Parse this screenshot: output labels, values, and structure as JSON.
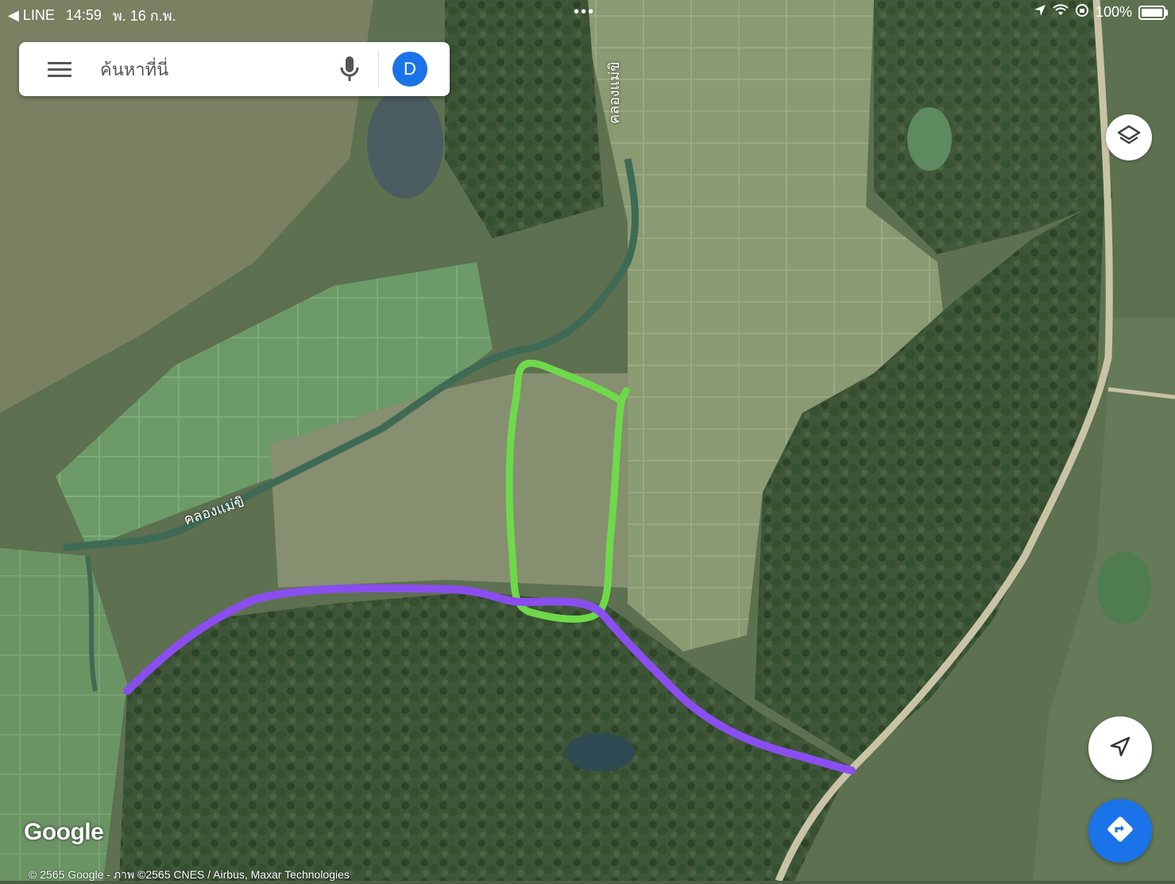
{
  "status_bar": {
    "back_app": "◀ LINE",
    "time": "14:59",
    "date": "พ. 16 ก.พ.",
    "dots": "•••",
    "battery": "100%",
    "battery_level": 1.0
  },
  "search": {
    "placeholder": "ค้นหาที่นี่",
    "avatar_letter": "D"
  },
  "map": {
    "labels": [
      {
        "text": "คลองแม่ขิ"
      },
      {
        "text": "คลองแม่ขิ"
      }
    ],
    "annotation_colors": {
      "boundary": "#6ed94a",
      "route": "#8a4ef0"
    }
  },
  "attribution": {
    "logo": "Google",
    "copyright": "© 2565 Google - ภาพ ©2565 CNES / Airbus, Maxar Technologies"
  },
  "icons": {
    "menu": "menu-icon",
    "mic": "mic-icon",
    "layers": "layers-icon",
    "locate": "navigation-arrow-icon",
    "directions": "directions-icon"
  },
  "colors": {
    "accent": "#1a73e8"
  }
}
